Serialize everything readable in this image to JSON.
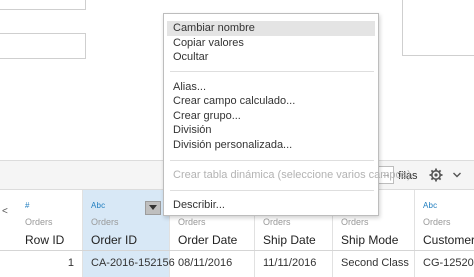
{
  "context_menu": {
    "items": [
      {
        "label": "Cambiar nombre",
        "enabled": true,
        "highlighted": true
      },
      {
        "label": "Copiar valores",
        "enabled": true
      },
      {
        "label": "Ocultar",
        "enabled": true
      },
      {
        "label": "Alias...",
        "enabled": true
      },
      {
        "label": "Crear campo calculado...",
        "enabled": true
      },
      {
        "label": "Crear grupo...",
        "enabled": true
      },
      {
        "label": "División",
        "enabled": true
      },
      {
        "label": "División personalizada...",
        "enabled": true
      },
      {
        "label": "Crear tabla dinámica (seleccione varios campos)",
        "enabled": false
      },
      {
        "label": "Describir...",
        "enabled": true
      }
    ]
  },
  "toolbar": {
    "rows_label": "filas",
    "stepper_glyph": "→",
    "icons": [
      "gear-icon",
      "chevron-down-icon"
    ]
  },
  "grid": {
    "edge_glyph": "<",
    "columns": [
      {
        "type": "#",
        "source": "Orders",
        "name": "Row ID",
        "value": "1",
        "selected": false
      },
      {
        "type": "Abc",
        "source": "Orders",
        "name": "Order ID",
        "value": "CA-2016-152156",
        "selected": true
      },
      {
        "type": "",
        "source": "Orders",
        "name": "Order Date",
        "value": "08/11/2016",
        "selected": false
      },
      {
        "type": "",
        "source": "Orders",
        "name": "Ship Date",
        "value": "11/11/2016",
        "selected": false
      },
      {
        "type": "Abc",
        "source": "Orders",
        "name": "Ship Mode",
        "value": "Second Class",
        "selected": false
      },
      {
        "type": "Abc",
        "source": "Orders",
        "name": "Customer ID",
        "value": "CG-12520",
        "selected": false
      }
    ]
  },
  "colors": {
    "selected_column": "#d8e8f6",
    "type_icon": "#1f7dbf",
    "menu_hover": "#e4e4e4",
    "menu_disabled_text": "#b3b3b3"
  }
}
